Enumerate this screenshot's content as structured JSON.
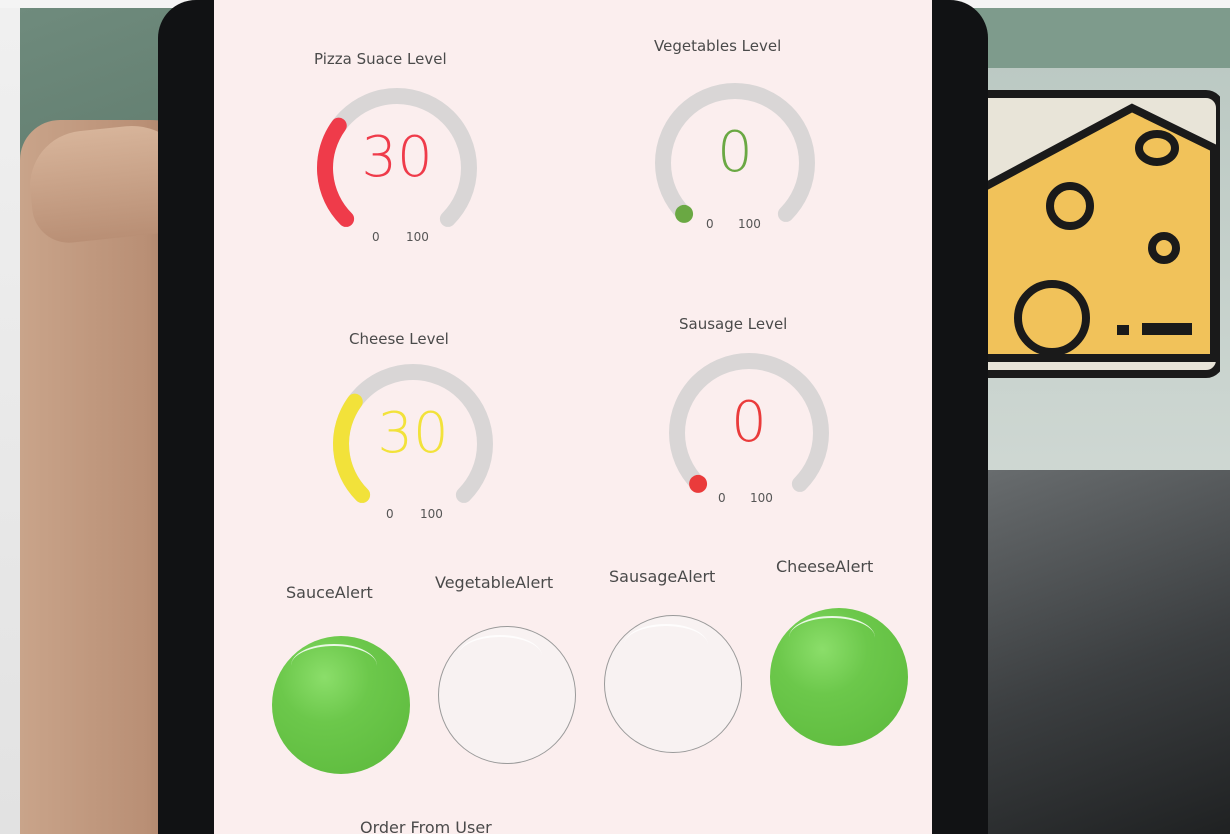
{
  "gauges": [
    {
      "id": "sauce",
      "title": "Pizza Suace Level",
      "value": "30",
      "fraction": 0.3,
      "min": "0",
      "max": "100",
      "color": "#ef3b4a"
    },
    {
      "id": "vegetables",
      "title": "Vegetables Level",
      "value": "0",
      "fraction": 0.0,
      "min": "0",
      "max": "100",
      "color": "#6aa843"
    },
    {
      "id": "cheese",
      "title": "Cheese Level",
      "value": "30",
      "fraction": 0.3,
      "min": "0",
      "max": "100",
      "color": "#f2e23a"
    },
    {
      "id": "sausage",
      "title": "Sausage Level",
      "value": "0",
      "fraction": 0.0,
      "min": "0",
      "max": "100",
      "color": "#ea3b3b"
    }
  ],
  "alerts": [
    {
      "label": "SauceAlert",
      "on": true
    },
    {
      "label": "VegetableAlert",
      "on": false
    },
    {
      "label": "SausageAlert",
      "on": false
    },
    {
      "label": "CheeseAlert",
      "on": true
    }
  ],
  "order_title": "Order From User",
  "colors": {
    "track": "#d9d6d6",
    "led_on": "#6cc84b",
    "screen_bg": "#fbeeee"
  }
}
